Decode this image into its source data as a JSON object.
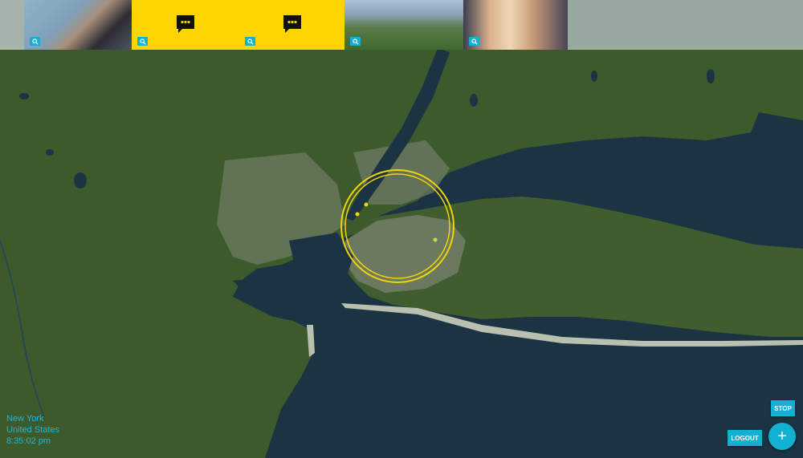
{
  "location": {
    "city": "New York",
    "country": "United States",
    "time": "8:35:02 pm"
  },
  "buttons": {
    "stop_label": "STOP",
    "logout_label": "LOGOUT",
    "add_label": "+"
  },
  "strip": {
    "items": [
      {
        "type": "photo",
        "icon": "search-icon"
      },
      {
        "type": "message",
        "icon": "chat-bubble-icon"
      },
      {
        "type": "message",
        "icon": "chat-bubble-icon"
      },
      {
        "type": "photo",
        "icon": "search-icon"
      },
      {
        "type": "photo",
        "icon": "search-icon"
      }
    ]
  },
  "map": {
    "type": "satellite",
    "selection_ring_color": "#f2d20a",
    "marker_colors": [
      "#f2d20a",
      "#b5e04a"
    ],
    "water_color": "#1b3343",
    "land_color": "#3f5a2d"
  }
}
